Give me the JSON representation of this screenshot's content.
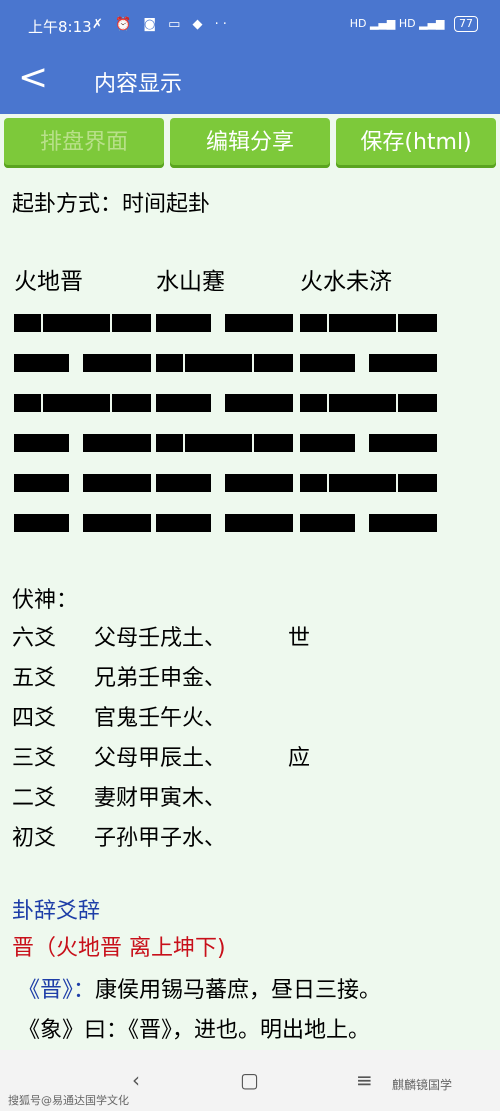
{
  "status": {
    "time": "上午8:13",
    "left_icons": "✗ ⏰ ◙ ▭ ◆ ··",
    "signal": "HD ▂▄▆ HD ▂▄▆",
    "battery": "77"
  },
  "header": {
    "back": "<",
    "title": "内容显示"
  },
  "toolbar": {
    "paipan": "排盘界面",
    "edit_share": "编辑分享",
    "save": "保存(html)"
  },
  "method": "起卦方式：时间起卦",
  "hexagrams": {
    "names": [
      "火地晋",
      "水山蹇",
      "火水未济"
    ],
    "lines": [
      [
        "yang",
        "yin",
        "yang"
      ],
      [
        "yin",
        "yang",
        "yin"
      ],
      [
        "yang",
        "yin",
        "yang"
      ],
      [
        "yin",
        "yang",
        "yin"
      ],
      [
        "yin",
        "yin",
        "yang"
      ],
      [
        "yin",
        "yin",
        "yin"
      ]
    ]
  },
  "fushen": {
    "label": "伏神：",
    "rows": [
      {
        "pos": "六爻",
        "text": "父母壬戌土、",
        "mark": "世"
      },
      {
        "pos": "五爻",
        "text": "兄弟壬申金、",
        "mark": ""
      },
      {
        "pos": "四爻",
        "text": "官鬼壬午火、",
        "mark": ""
      },
      {
        "pos": "三爻",
        "text": "父母甲辰土、",
        "mark": "应"
      },
      {
        "pos": "二爻",
        "text": "妻财甲寅木、",
        "mark": ""
      },
      {
        "pos": "初爻",
        "text": "子孙甲子水、",
        "mark": ""
      }
    ]
  },
  "guaci": {
    "heading": "卦辞爻辞",
    "gua_title": "晋（火地晋 离上坤下)",
    "line1_book": "《晋》：",
    "line1_text": "康侯用锡马蕃庶，昼日三接。",
    "line2": "《象》曰：《晋》，进也。明出地上。"
  },
  "nav": {
    "back": "‹",
    "home": "▢",
    "menu": "≡"
  },
  "watermark": {
    "left": "搜狐号@易通达国学文化",
    "right": "麒麟镜国学"
  }
}
